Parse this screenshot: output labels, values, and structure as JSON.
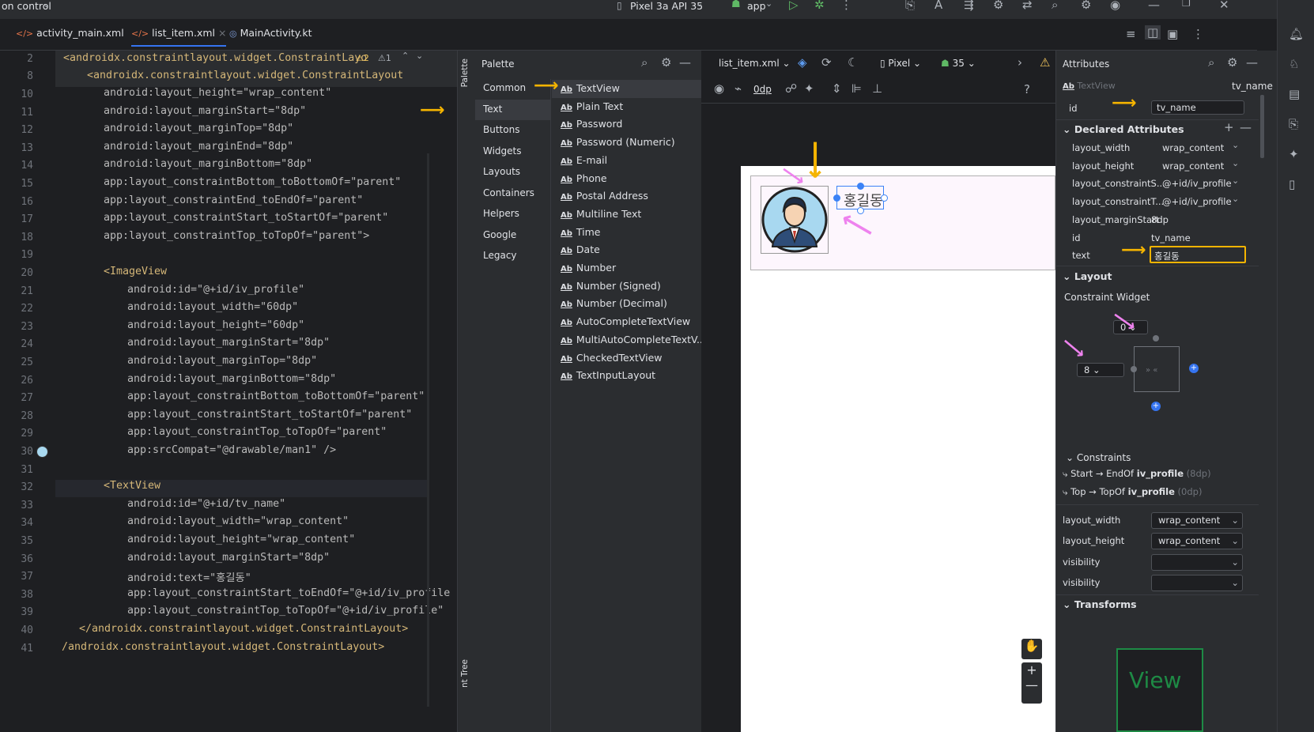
{
  "topbar": {
    "project": "on control",
    "device": "Pixel 3a API 35",
    "run_config": "app"
  },
  "tabs": [
    {
      "label": "activity_main.xml"
    },
    {
      "label": "list_item.xml"
    },
    {
      "label": "MainActivity.kt"
    }
  ],
  "editor": {
    "header1": "<androidx.constraintlayout.widget.ConstraintLayo",
    "header2": "<androidx.constraintlayout.widget.ConstraintLayout",
    "warnings": "2",
    "weak_warnings": "1",
    "lines": [
      {
        "n": "10",
        "t": "android:layout_height=\"wrap_content\""
      },
      {
        "n": "11",
        "t": "android:layout_marginStart=\"8dp\""
      },
      {
        "n": "12",
        "t": "android:layout_marginTop=\"8dp\""
      },
      {
        "n": "13",
        "t": "android:layout_marginEnd=\"8dp\""
      },
      {
        "n": "14",
        "t": "android:layout_marginBottom=\"8dp\""
      },
      {
        "n": "15",
        "t": "app:layout_constraintBottom_toBottomOf=\"parent\""
      },
      {
        "n": "16",
        "t": "app:layout_constraintEnd_toEndOf=\"parent\""
      },
      {
        "n": "17",
        "t": "app:layout_constraintStart_toStartOf=\"parent\""
      },
      {
        "n": "18",
        "t": "app:layout_constraintTop_toTopOf=\"parent\">"
      },
      {
        "n": "19",
        "t": ""
      },
      {
        "n": "20",
        "t": "<ImageView"
      },
      {
        "n": "21",
        "t": "android:id=\"@+id/iv_profile\""
      },
      {
        "n": "22",
        "t": "android:layout_width=\"60dp\""
      },
      {
        "n": "23",
        "t": "android:layout_height=\"60dp\""
      },
      {
        "n": "24",
        "t": "android:layout_marginStart=\"8dp\""
      },
      {
        "n": "25",
        "t": "android:layout_marginTop=\"8dp\""
      },
      {
        "n": "26",
        "t": "android:layout_marginBottom=\"8dp\""
      },
      {
        "n": "27",
        "t": "app:layout_constraintBottom_toBottomOf=\"parent\""
      },
      {
        "n": "28",
        "t": "app:layout_constraintStart_toStartOf=\"parent\""
      },
      {
        "n": "29",
        "t": "app:layout_constraintTop_toTopOf=\"parent\""
      },
      {
        "n": "30",
        "t": "app:srcCompat=\"@drawable/man1\" />"
      },
      {
        "n": "31",
        "t": ""
      },
      {
        "n": "32",
        "t": "<TextView"
      },
      {
        "n": "33",
        "t": "android:id=\"@+id/tv_name\""
      },
      {
        "n": "34",
        "t": "android:layout_width=\"wrap_content\""
      },
      {
        "n": "35",
        "t": "android:layout_height=\"wrap_content\""
      },
      {
        "n": "36",
        "t": "android:layout_marginStart=\"8dp\""
      },
      {
        "n": "37",
        "t": "android:text=\"홍길동\""
      },
      {
        "n": "38",
        "t": "app:layout_constraintStart_toEndOf=\"@+id/iv_profile"
      },
      {
        "n": "39",
        "t": "app:layout_constraintTop_toTopOf=\"@+id/iv_profile\""
      },
      {
        "n": "40",
        "t": "</androidx.constraintlayout.widget.ConstraintLayout>"
      },
      {
        "n": "41",
        "t": "/androidx.constraintlayout.widget.ConstraintLayout>"
      }
    ],
    "first_line_numbers": [
      "2",
      "8"
    ]
  },
  "palette": {
    "title": "Palette",
    "strip_label": "Palette",
    "tree_label": "nt Tree",
    "categories": [
      "Common",
      "Text",
      "Buttons",
      "Widgets",
      "Layouts",
      "Containers",
      "Helpers",
      "Google",
      "Legacy"
    ],
    "items": [
      "TextView",
      "Plain Text",
      "Password",
      "Password (Numeric)",
      "E-mail",
      "Phone",
      "Postal Address",
      "Multiline Text",
      "Time",
      "Date",
      "Number",
      "Number (Signed)",
      "Number (Decimal)",
      "AutoCompleteTextView",
      "MultiAutoCompleteTextV...",
      "CheckedTextView",
      "TextInputLayout"
    ],
    "ab": "Ab"
  },
  "design": {
    "file": "list_item.xml",
    "device": "Pixel",
    "api": "35",
    "margin": "0dp",
    "preview_text": "홍길동",
    "help": "?"
  },
  "attributes": {
    "title": "Attributes",
    "type": "TextView",
    "name": "tv_name",
    "id_label": "id",
    "id_value": "tv_name",
    "declared_title": "Declared Attributes",
    "declared": [
      {
        "k": "layout_width",
        "v": "wrap_content"
      },
      {
        "k": "layout_height",
        "v": "wrap_content"
      },
      {
        "k": "layout_constraintS...",
        "v": "@+id/iv_profile"
      },
      {
        "k": "layout_constraintT...",
        "v": "@+id/iv_profile"
      },
      {
        "k": "layout_marginStart",
        "v": "8dp"
      },
      {
        "k": "id",
        "v": "tv_name"
      },
      {
        "k": "text",
        "v": "홍길동"
      }
    ],
    "layout_title": "Layout",
    "constraint_widget": "Constraint Widget",
    "top_margin": "0",
    "start_margin": "8",
    "constraints_title": "Constraints",
    "constraint1": {
      "a": "Start → EndOf ",
      "b": "iv_profile",
      "c": " (8dp)"
    },
    "constraint2": {
      "a": "Top → TopOf ",
      "b": "iv_profile",
      "c": " (0dp)"
    },
    "props": [
      {
        "k": "layout_width",
        "v": "wrap_content"
      },
      {
        "k": "layout_height",
        "v": "wrap_content"
      },
      {
        "k": "visibility",
        "v": ""
      },
      {
        "k": "visibility",
        "v": ""
      }
    ],
    "transforms_title": "Transforms",
    "view_preview": "View"
  }
}
